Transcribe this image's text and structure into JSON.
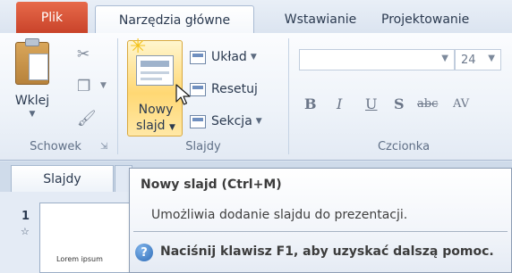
{
  "tabs": {
    "file": "Plik",
    "home": "Narzędzia główne",
    "insert": "Wstawianie",
    "design": "Projektowanie"
  },
  "clipboard": {
    "paste_label": "Wklej",
    "group_label": "Schowek"
  },
  "slides_group": {
    "new_slide_label_line1": "Nowy",
    "new_slide_label_line2": "slajd",
    "layout_label": "Układ",
    "reset_label": "Resetuj",
    "section_label": "Sekcja",
    "group_label": "Slajdy"
  },
  "font_group": {
    "font_name": "",
    "font_size": "24",
    "bold": "B",
    "italic": "I",
    "underline": "U",
    "shadow": "S",
    "strikethrough": "abc",
    "spacing": "AV",
    "group_label": "Czcionka"
  },
  "slides_pane": {
    "tab_label": "Slajdy",
    "slide_number": "1",
    "thumbnail_text": "Lorem ipsum"
  },
  "tooltip": {
    "title": "Nowy slajd (Ctrl+M)",
    "description": "Umożliwia dodanie slajdu do prezentacji.",
    "help_text": "Naciśnij klawisz F1, aby uzyskać dalszą pomoc."
  },
  "colors": {
    "file_tab": "#d5553a",
    "ribbon_bg": "#eef3f9",
    "highlight": "#ffd874"
  }
}
